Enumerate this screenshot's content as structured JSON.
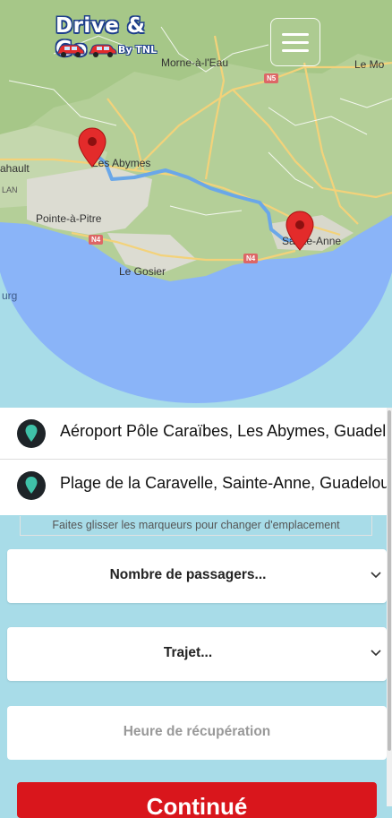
{
  "app": {
    "logo_title": "Drive & Go",
    "logo_sub": "By TNL"
  },
  "map": {
    "places": {
      "morne_a_leau": "Morne-à-l'Eau",
      "le_mo": "Le Mo",
      "baie_mahault": "ahault",
      "lan": "LAN",
      "les_abymes": "Les Abymes",
      "pointe_a_pitre": "Pointe-à-Pitre",
      "sainte_anne": "Sainte-Anne",
      "le_gosier": "Le Gosier",
      "burg": "urg"
    },
    "roads": {
      "n5": "N5",
      "n4_west": "N4",
      "n4_east": "N4"
    },
    "route_color": "#6aa7e8",
    "marker_color": "#e32b2b"
  },
  "pickup": {
    "label": "Aéroport Pôle Caraïbes, Les Abymes, Guadeloupe"
  },
  "dropoff": {
    "label": "Plage de la Caravelle, Sainte-Anne, Guadeloupe"
  },
  "hint": "Faites glisser les marqueurs pour changer d'emplacement",
  "form": {
    "passengers_placeholder": "Nombre de passagers...",
    "trip_placeholder": "Trajet...",
    "pickup_time_placeholder": "Heure de récupération",
    "submit_label": "Continué"
  },
  "colors": {
    "accent_red": "#d9161c",
    "pin_green": "#3fc1a8",
    "background": "#a8dce8"
  }
}
